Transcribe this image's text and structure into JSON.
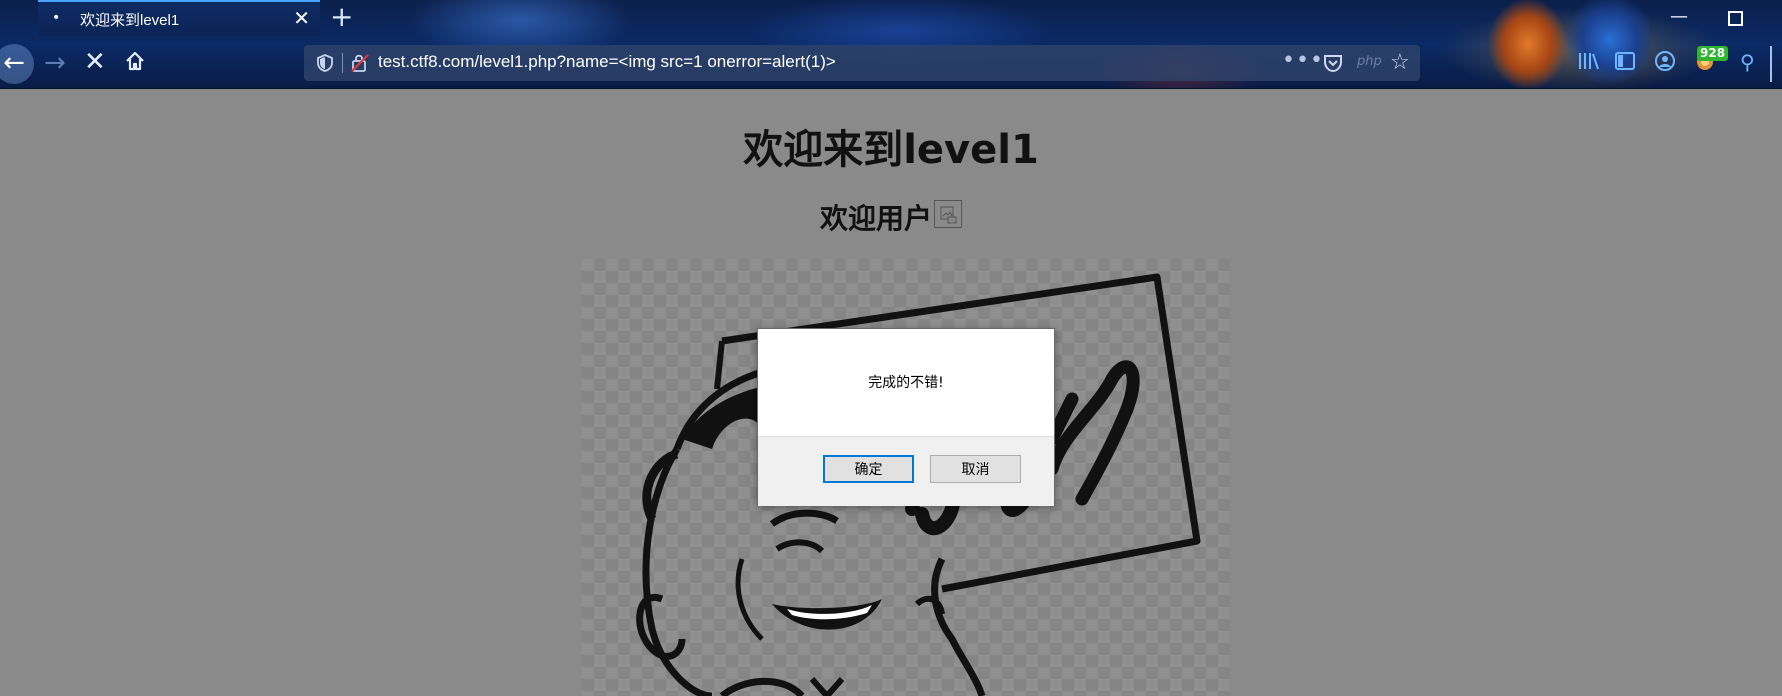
{
  "browser": {
    "tab": {
      "title": "欢迎来到level1"
    },
    "url": {
      "host": "test.ctf8.com",
      "rest": "/level1.php?name=<img src=1 onerror=alert(1)>"
    },
    "php_label": "php",
    "badge_count": "928"
  },
  "page": {
    "heading": "欢迎来到level1",
    "subheading": "欢迎用户"
  },
  "dialog": {
    "message": "完成的不错!",
    "ok_label": "确定",
    "cancel_label": "取消"
  }
}
